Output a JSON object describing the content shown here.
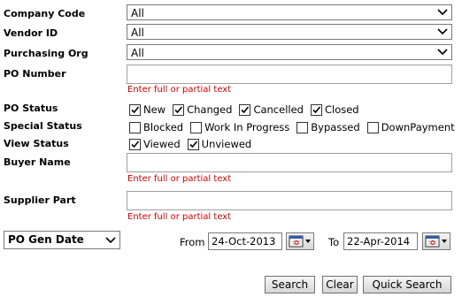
{
  "fields": {
    "company_code": {
      "label": "Company Code",
      "value": "All"
    },
    "vendor_id": {
      "label": "Vendor ID",
      "value": "All"
    },
    "purchasing_org": {
      "label": "Purchasing Org",
      "value": "All"
    },
    "po_number": {
      "label": "PO Number",
      "value": "",
      "hint": "Enter full or partial text"
    },
    "buyer_name": {
      "label": "Buyer Name",
      "value": "",
      "hint": "Enter full or partial text"
    },
    "supplier_part": {
      "label": "Supplier Part",
      "value": "",
      "hint": "Enter full or partial text"
    }
  },
  "po_status": {
    "label": "PO Status",
    "options": [
      {
        "label": "New",
        "checked": true
      },
      {
        "label": "Changed",
        "checked": true
      },
      {
        "label": "Cancelled",
        "checked": true
      },
      {
        "label": "Closed",
        "checked": true
      }
    ]
  },
  "special_status": {
    "label": "Special Status",
    "options": [
      {
        "label": "Blocked",
        "checked": false
      },
      {
        "label": "Work In Progress",
        "checked": false
      },
      {
        "label": "Bypassed",
        "checked": false
      },
      {
        "label": "DownPayment",
        "checked": false
      }
    ]
  },
  "view_status": {
    "label": "View Status",
    "options": [
      {
        "label": "Viewed",
        "checked": true
      },
      {
        "label": "Unviewed",
        "checked": true
      }
    ]
  },
  "date_range": {
    "type_value": "PO Gen Date",
    "from_label": "From",
    "from_value": "24-Oct-2013",
    "to_label": "To",
    "to_value": "22-Apr-2014"
  },
  "buttons": {
    "search": "Search",
    "clear": "Clear",
    "quick_search": "Quick Search"
  },
  "icons": {
    "dropdown": "chevron-down-icon",
    "calendar": "calendar-icon"
  }
}
